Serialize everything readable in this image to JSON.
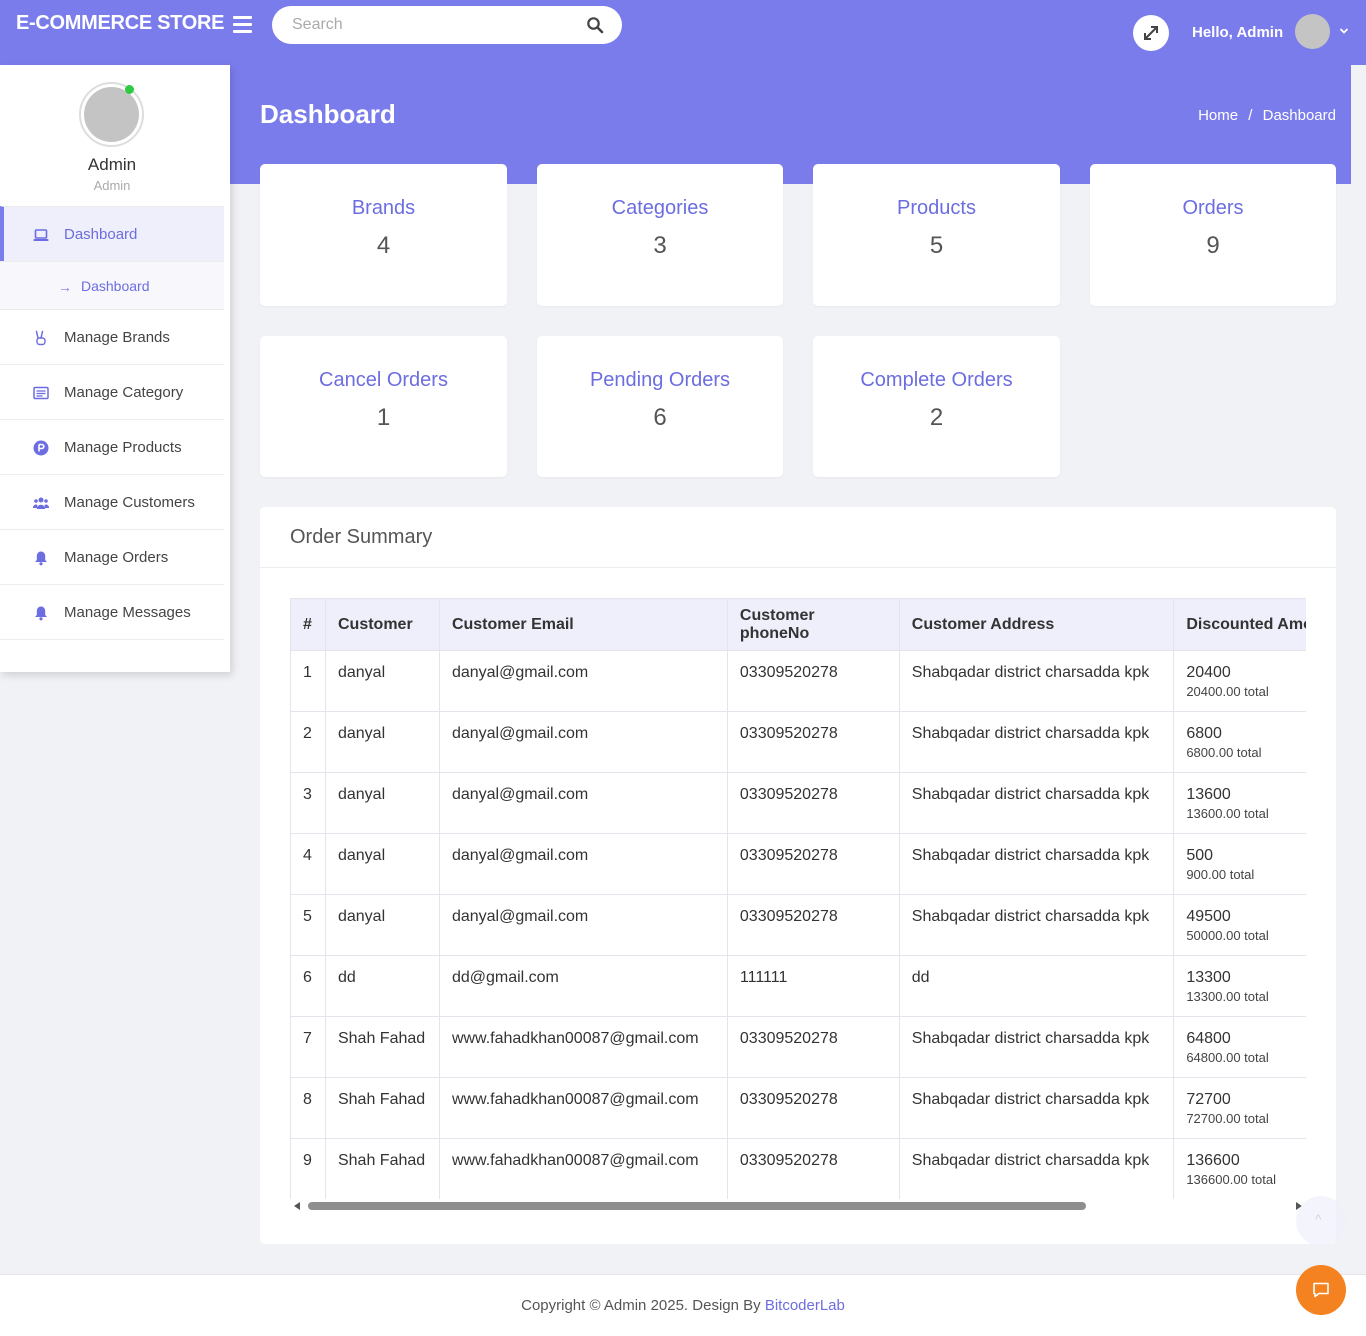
{
  "topbar": {
    "brand": "E-COMMERCE STORE",
    "search_placeholder": "Search",
    "greeting_hello": "Hello,",
    "greeting_name": "Admin",
    "accent_color": "#7b7cec"
  },
  "sidebar": {
    "user_name": "Admin",
    "user_role": "Admin",
    "items": [
      {
        "label": "Dashboard",
        "icon": "laptop-icon",
        "active": true
      },
      {
        "label": "Manage Brands",
        "icon": "peace-hand-icon"
      },
      {
        "label": "Manage Category",
        "icon": "list-card-icon"
      },
      {
        "label": "Manage Products",
        "icon": "product-p-icon"
      },
      {
        "label": "Manage Customers",
        "icon": "users-icon"
      },
      {
        "label": "Manage Orders",
        "icon": "bell-icon"
      },
      {
        "label": "Manage Messages",
        "icon": "bell-icon"
      }
    ],
    "sub_items": [
      {
        "label": "Dashboard"
      }
    ]
  },
  "header": {
    "title": "Dashboard",
    "breadcrumb": [
      "Home",
      "Dashboard"
    ],
    "breadcrumb_sep": "/"
  },
  "stats": [
    {
      "title": "Brands",
      "value": "4"
    },
    {
      "title": "Categories",
      "value": "3"
    },
    {
      "title": "Products",
      "value": "5"
    },
    {
      "title": "Orders",
      "value": "9"
    },
    {
      "title": "Cancel Orders",
      "value": "1"
    },
    {
      "title": "Pending Orders",
      "value": "6"
    },
    {
      "title": "Complete Orders",
      "value": "2"
    }
  ],
  "summary": {
    "title": "Order Summary",
    "columns": [
      "#",
      "Customer",
      "Customer Email",
      "Customer phoneNo",
      "Customer Address",
      "Discounted Amount"
    ],
    "rows": [
      {
        "num": "1",
        "customer": "danyal",
        "email": "danyal@gmail.com",
        "phone": "03309520278",
        "address": "Shabqadar district charsadda kpk",
        "discounted": "20400",
        "total": "20400.00 total"
      },
      {
        "num": "2",
        "customer": "danyal",
        "email": "danyal@gmail.com",
        "phone": "03309520278",
        "address": "Shabqadar district charsadda kpk",
        "discounted": "6800",
        "total": "6800.00 total"
      },
      {
        "num": "3",
        "customer": "danyal",
        "email": "danyal@gmail.com",
        "phone": "03309520278",
        "address": "Shabqadar district charsadda kpk",
        "discounted": "13600",
        "total": "13600.00 total"
      },
      {
        "num": "4",
        "customer": "danyal",
        "email": "danyal@gmail.com",
        "phone": "03309520278",
        "address": "Shabqadar district charsadda kpk",
        "discounted": "500",
        "total": "900.00 total"
      },
      {
        "num": "5",
        "customer": "danyal",
        "email": "danyal@gmail.com",
        "phone": "03309520278",
        "address": "Shabqadar district charsadda kpk",
        "discounted": "49500",
        "total": "50000.00 total"
      },
      {
        "num": "6",
        "customer": "dd",
        "email": "dd@gmail.com",
        "phone": "111111",
        "address": "dd",
        "discounted": "13300",
        "total": "13300.00 total"
      },
      {
        "num": "7",
        "customer": "Shah Fahad",
        "email": "www.fahadkhan00087@gmail.com",
        "phone": "03309520278",
        "address": "Shabqadar district charsadda kpk",
        "discounted": "64800",
        "total": "64800.00 total"
      },
      {
        "num": "8",
        "customer": "Shah Fahad",
        "email": "www.fahadkhan00087@gmail.com",
        "phone": "03309520278",
        "address": "Shabqadar district charsadda kpk",
        "discounted": "72700",
        "total": "72700.00 total"
      },
      {
        "num": "9",
        "customer": "Shah Fahad",
        "email": "www.fahadkhan00087@gmail.com",
        "phone": "03309520278",
        "address": "Shabqadar district charsadda kpk",
        "discounted": "136600",
        "total": "136600.00 total"
      }
    ]
  },
  "footer": {
    "text": "Copyright © Admin 2025. Design By",
    "link": "BitcoderLab"
  },
  "colors": {
    "accent": "#7b7cec",
    "chat_button": "#f58220",
    "online": "#2ecc40"
  }
}
